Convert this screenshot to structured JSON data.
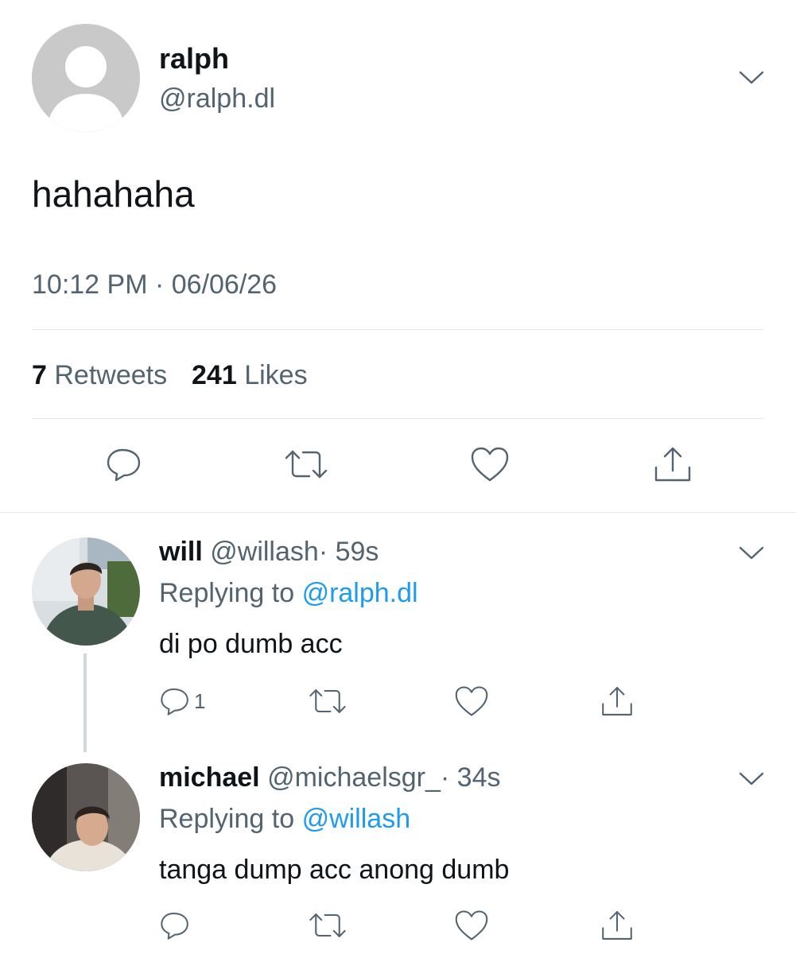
{
  "tweet": {
    "name": "ralph",
    "handle": "@ralph.dl",
    "text": "hahahaha",
    "timestamp": "10:12 PM · 06/06/26",
    "retweets_count": "7",
    "retweets_label": "Retweets",
    "likes_count": "241",
    "likes_label": "Likes",
    "avatar": "default-avatar-icon"
  },
  "replies": [
    {
      "name": "will",
      "handle": "@willash",
      "time": "· 59s",
      "replying_prefix": "Replying to",
      "replying_to": "@ralph.dl",
      "text": "di po dumb acc",
      "reply_count": "1"
    },
    {
      "name": "michael",
      "handle": "@michaelsgr_",
      "time": "· 34s",
      "replying_prefix": "Replying to",
      "replying_to": "@willash",
      "text": "tanga dump acc anong dumb",
      "reply_count": ""
    }
  ],
  "icons": [
    "chevron-down-icon",
    "reply-icon",
    "retweet-icon",
    "like-icon",
    "share-icon"
  ],
  "colors": {
    "text": "#0f1419",
    "secondary": "#536471",
    "link": "#1d9bf0",
    "divider": "#e1e8ed"
  }
}
